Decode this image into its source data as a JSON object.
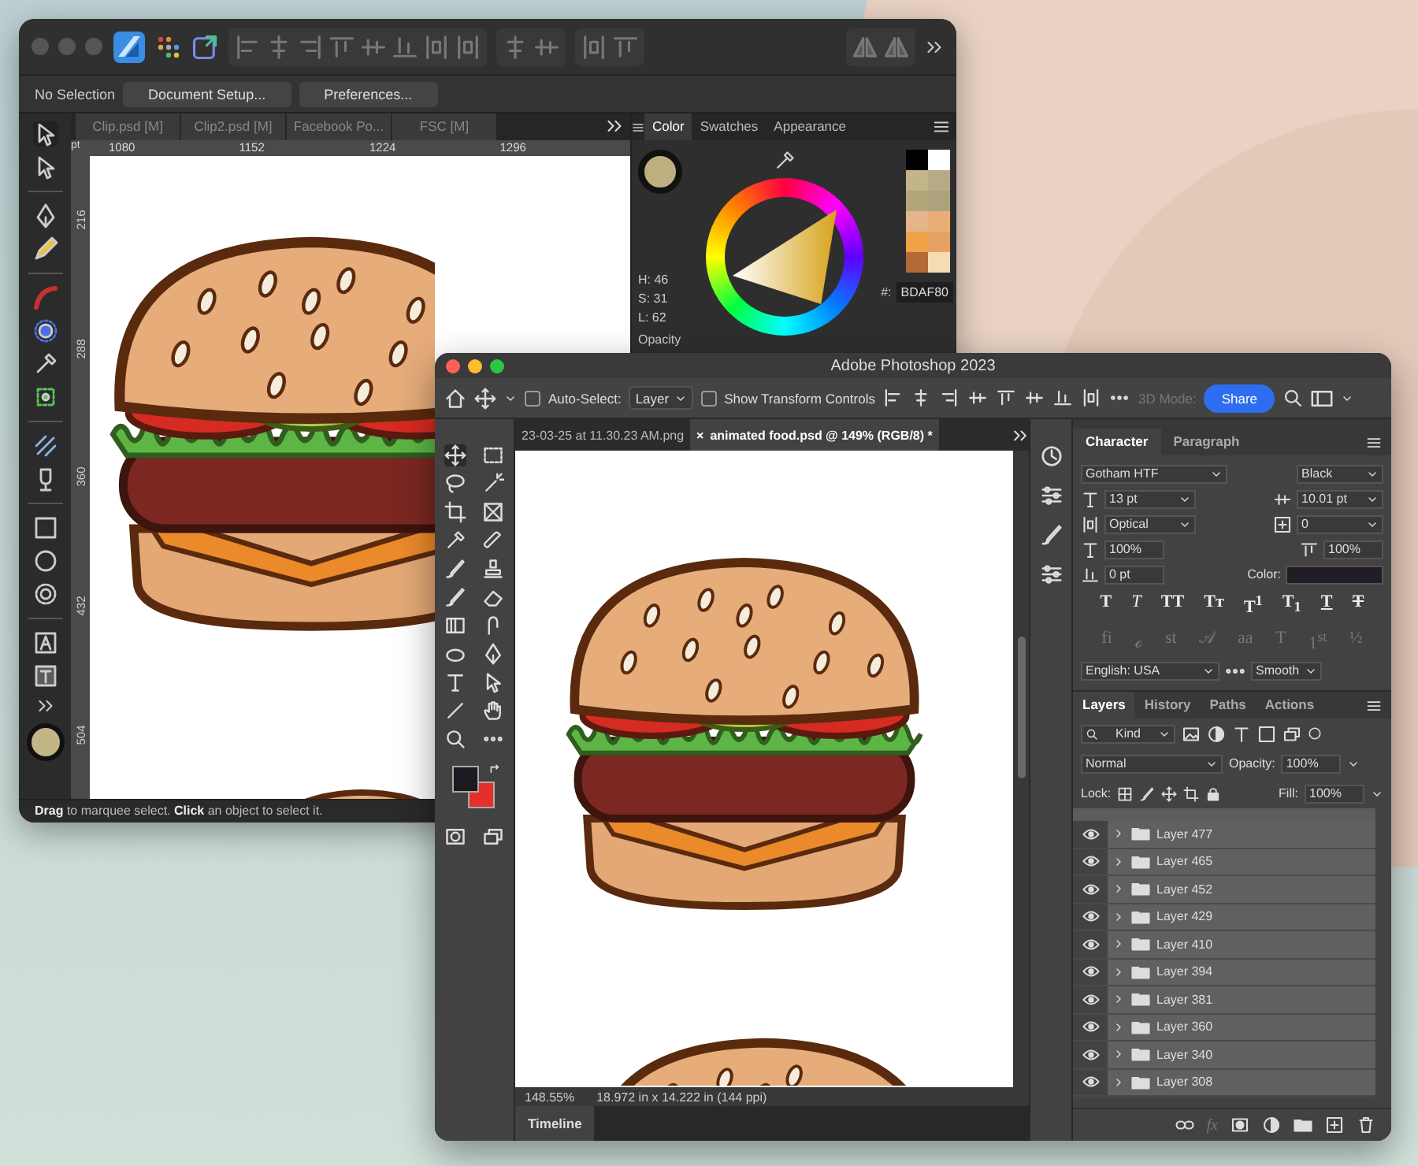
{
  "affinity": {
    "context_bar": {
      "selection": "No Selection",
      "buttons": [
        "Document Setup...",
        "Preferences..."
      ]
    },
    "doc_tabs": [
      {
        "label": "Clip.psd [M]",
        "selected": false
      },
      {
        "label": "Clip2.psd [M]",
        "selected": false
      },
      {
        "label": "Facebook Po...",
        "selected": false
      },
      {
        "label": "FSC [M]",
        "selected": false
      }
    ],
    "ruler": {
      "unit": "pt",
      "h_ticks": [
        "1080",
        "1152",
        "1224",
        "1296"
      ],
      "v_ticks": [
        "216",
        "288",
        "360",
        "432",
        "504"
      ]
    },
    "color_panel": {
      "tabs": [
        {
          "label": "Color",
          "selected": true
        },
        {
          "label": "Swatches",
          "selected": false
        },
        {
          "label": "Appearance",
          "selected": false
        }
      ],
      "hsl": [
        "H: 46",
        "S: 31",
        "L: 62"
      ],
      "hex_label": "#:",
      "hex": "BDAF80",
      "opacity_label": "Opacity",
      "swatches": [
        {
          "color": "#000000"
        },
        {
          "color": "#ffffff"
        },
        {
          "color": "#c2b58a"
        },
        {
          "color": "#b6ab85"
        },
        {
          "color": "#b3a67a"
        },
        {
          "color": "#aca27c"
        },
        {
          "color": "#e4b48a"
        },
        {
          "color": "#e8ae78"
        },
        {
          "color": "#efa148"
        },
        {
          "color": "#e6a163"
        },
        {
          "color": "#b46a36"
        },
        {
          "color": "#f5dcb3"
        }
      ]
    },
    "status": "**Drag** to marquee select. **Click** an object to select it."
  },
  "photoshop": {
    "title": "Adobe Photoshop 2023",
    "options_bar": {
      "auto_select": {
        "label": "Auto-Select:",
        "checked": false
      },
      "target": "Layer",
      "show_transform": {
        "label": "Show Transform Controls",
        "checked": false
      },
      "mode_3d": "3D Mode:",
      "share": "Share"
    },
    "doc_tabs": [
      {
        "label": "23-03-25 at 11.30.23 AM.png",
        "selected": false
      },
      {
        "label": "animated food.psd @ 149% (RGB/8) *",
        "selected": true
      }
    ],
    "close_glyph": "×",
    "zoom": "148.55%",
    "doc_info": "18.972 in x 14.222 in (144 ppi)",
    "timeline": "Timeline",
    "character": {
      "tabs": [
        {
          "label": "Character",
          "selected": true
        },
        {
          "label": "Paragraph",
          "selected": false
        }
      ],
      "font": "Gotham HTF",
      "style": "Black",
      "size": "13 pt",
      "leading": "10.01 pt",
      "kerning": "Optical",
      "tracking": "0",
      "vertical_scale": "100%",
      "horizontal_scale": "100%",
      "baseline_shift": "0 pt",
      "color_label": "Color:",
      "style_buttons": [
        {
          "glyph": "T",
          "kind": "bold"
        },
        {
          "glyph": "T",
          "kind": "italic"
        },
        {
          "glyph": "TT",
          "kind": "caps"
        },
        {
          "glyph": "Tт",
          "kind": "smallcaps"
        },
        {
          "glyph": "T$^{1}$",
          "kind": "super"
        },
        {
          "glyph": "T$_{1}$",
          "kind": "sub"
        },
        {
          "glyph": "T",
          "kind": "underline"
        },
        {
          "glyph": "T",
          "kind": "strike"
        }
      ],
      "opentype_buttons": [
        {
          "glyph": "fi",
          "disabled": true
        },
        {
          "glyph": "ℴ",
          "disabled": true
        },
        {
          "glyph": "st",
          "disabled": true
        },
        {
          "glyph": "𝒜",
          "disabled": true
        },
        {
          "glyph": "aa",
          "disabled": true
        },
        {
          "glyph": "T",
          "disabled": true
        },
        {
          "glyph": "1$^{st}$",
          "disabled": true
        },
        {
          "glyph": "½",
          "disabled": true
        }
      ],
      "language": "English: USA",
      "antialias": "Smooth"
    },
    "layers": {
      "tabs": [
        {
          "label": "Layers",
          "selected": true
        },
        {
          "label": "History",
          "selected": false
        },
        {
          "label": "Paths",
          "selected": false
        },
        {
          "label": "Actions",
          "selected": false
        }
      ],
      "filter": "Kind",
      "blend_mode": "Normal",
      "opacity_label": "Opacity:",
      "opacity": "100%",
      "lock_label": "Lock:",
      "fill_label": "Fill:",
      "fill": "100%",
      "rows": [
        {
          "name": "Layer 477",
          "visible": true,
          "expanded": false
        },
        {
          "name": "Layer 465",
          "visible": true,
          "expanded": false
        },
        {
          "name": "Layer 452",
          "visible": true,
          "expanded": false
        },
        {
          "name": "Layer 429",
          "visible": true,
          "expanded": false
        },
        {
          "name": "Layer 410",
          "visible": true,
          "expanded": false
        },
        {
          "name": "Layer 394",
          "visible": true,
          "expanded": false
        },
        {
          "name": "Layer 381",
          "visible": true,
          "expanded": false
        },
        {
          "name": "Layer 360",
          "visible": true,
          "expanded": false
        },
        {
          "name": "Layer 340",
          "visible": true,
          "expanded": false
        },
        {
          "name": "Layer 308",
          "visible": true,
          "expanded": false
        }
      ],
      "fx_label": "fx"
    }
  }
}
